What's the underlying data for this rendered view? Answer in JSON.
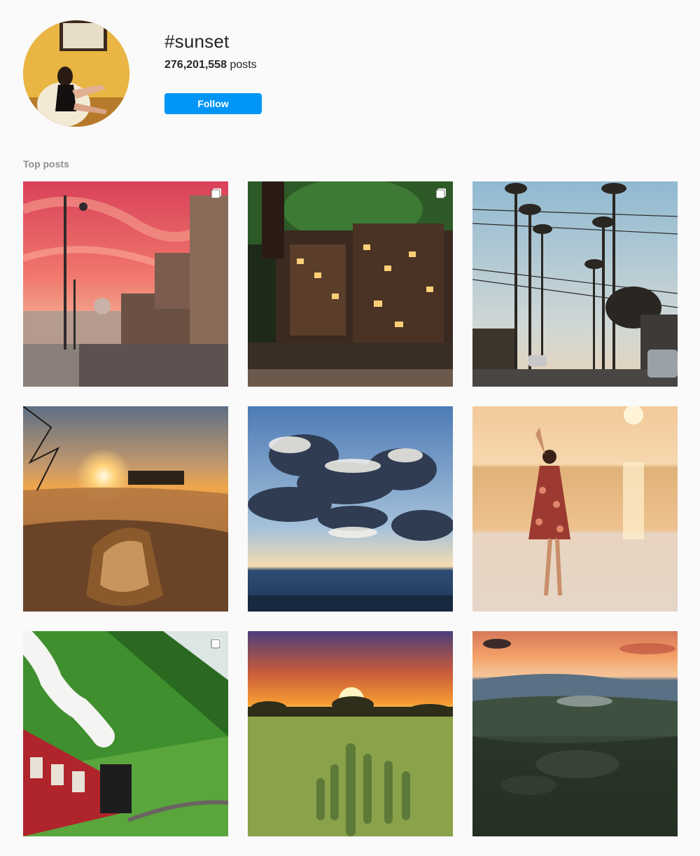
{
  "profile": {
    "hashtag": "#sunset",
    "post_count": "276,201,558",
    "post_word": "posts",
    "follow_label": "Follow"
  },
  "section": {
    "label": "Top posts"
  },
  "posts": [
    {
      "scene": "rome-castle-sunset",
      "multi": true
    },
    {
      "scene": "japanese-ryokan-street",
      "multi": true
    },
    {
      "scene": "palm-tree-street",
      "multi": false
    },
    {
      "scene": "snowy-boat-sunset",
      "multi": false
    },
    {
      "scene": "cloudy-ocean-sunrays",
      "multi": false
    },
    {
      "scene": "dancing-woman-beach",
      "multi": false
    },
    {
      "scene": "steam-train-mountain",
      "multi": true
    },
    {
      "scene": "cactus-field-sunset",
      "multi": false
    },
    {
      "scene": "misty-forest-hills",
      "multi": false
    }
  ],
  "colors": {
    "accent": "#0095f6",
    "background": "#fafafa",
    "muted_text": "#8e8e8e"
  }
}
